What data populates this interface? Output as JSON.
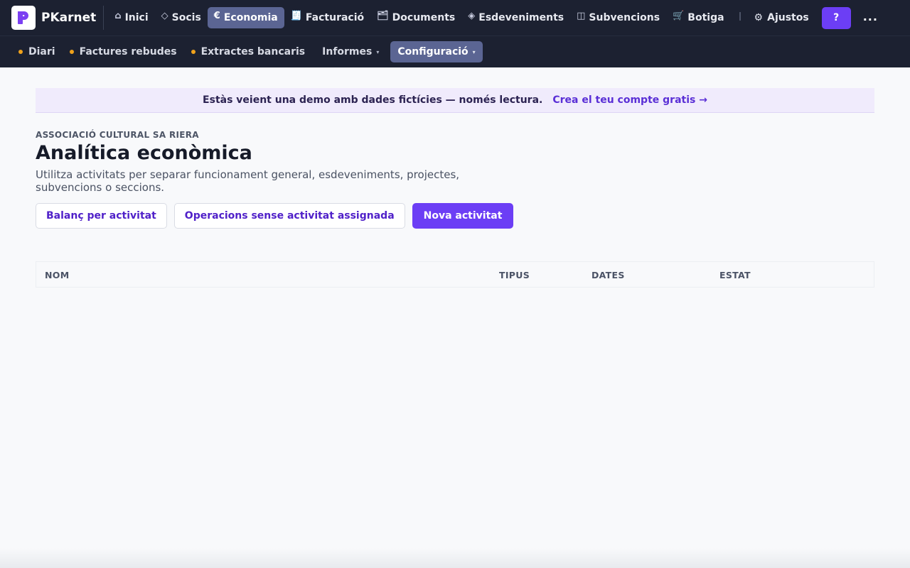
{
  "brand": {
    "name": "PKarnet",
    "logo_letter": "P",
    "logo_color": "#7b3ff2"
  },
  "nav": {
    "items": [
      {
        "icon": "home-icon",
        "glyph": "⌂",
        "label": "Inici"
      },
      {
        "icon": "diamond-icon",
        "glyph": "◇",
        "label": "Socis"
      },
      {
        "icon": "euro-icon",
        "glyph": "€",
        "label": "Economia",
        "active": true
      },
      {
        "icon": "receipt-icon",
        "glyph": "🧾",
        "label": "Facturació"
      },
      {
        "icon": "folder-icon",
        "glyph": "🗂",
        "label": "Documents"
      },
      {
        "icon": "event-icon",
        "glyph": "◈",
        "label": "Esdeveniments"
      },
      {
        "icon": "book-icon",
        "glyph": "◫",
        "label": "Subvencions"
      },
      {
        "icon": "cart-icon",
        "glyph": "🛒",
        "label": "Botiga"
      }
    ],
    "settings_label": "Ajustos",
    "settings_glyph": "⚙",
    "help_label": "?",
    "more_label": "..."
  },
  "subnav": {
    "items": [
      {
        "label": "Diari",
        "dot": true
      },
      {
        "label": "Factures rebudes",
        "dot": true
      },
      {
        "label": "Extractes bancaris",
        "dot": true
      },
      {
        "label": "Informes",
        "caret": "▾"
      },
      {
        "label": "Configuració",
        "caret": "▾",
        "active": true
      }
    ]
  },
  "banner": {
    "text": "Estàs veient una demo amb dades fictícies — només lectura.",
    "link": "Crea el teu compte gratis →"
  },
  "header": {
    "org": "ASSOCIACIÓ CULTURAL SA RIERA",
    "title": "Analítica econòmica",
    "description": "Utilitza activitats per separar funcionament general, esdeveniments, projectes, subvencions o seccions."
  },
  "actions": {
    "balance": "Balanç per activitat",
    "unassigned": "Operacions sense activitat assignada",
    "new": "Nova activitat"
  },
  "table": {
    "columns": [
      "NOM",
      "TIPUS",
      "DATES",
      "ESTAT"
    ]
  },
  "colors": {
    "nav_bg": "#1c2131",
    "accent": "#6c3ef5",
    "active_tab": "#5b6593",
    "dot": "#f0a21b"
  }
}
